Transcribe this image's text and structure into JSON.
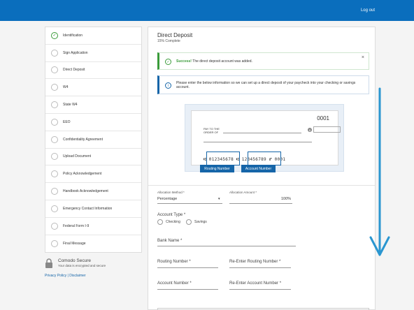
{
  "header": {
    "logout_label": "Log out",
    "brand_color": "#0a6ebd"
  },
  "steps": [
    {
      "label": "Identification",
      "status": "complete"
    },
    {
      "label": "Sign Application",
      "status": "incomplete"
    },
    {
      "label": "Direct Deposit",
      "status": "incomplete"
    },
    {
      "label": "W4",
      "status": "incomplete"
    },
    {
      "label": "State W4",
      "status": "incomplete"
    },
    {
      "label": "EEO",
      "status": "incomplete"
    },
    {
      "label": "Confidentiality Agreement",
      "status": "incomplete"
    },
    {
      "label": "Upload Document",
      "status": "incomplete"
    },
    {
      "label": "Policy Acknowledgement",
      "status": "incomplete"
    },
    {
      "label": "Handbook Acknowledgement",
      "status": "incomplete"
    },
    {
      "label": "Emergency Contact Information",
      "status": "incomplete"
    },
    {
      "label": "Federal Form I-9",
      "status": "incomplete"
    },
    {
      "label": "Final Message",
      "status": "incomplete"
    }
  ],
  "secure": {
    "title": "Comodo Secure",
    "subtitle": "Your data is encrypted and secure",
    "privacy_label": "Privacy Policy",
    "separator": "|",
    "disclaimer_label": "Disclaimer"
  },
  "main": {
    "title": "Direct Deposit",
    "progress_text": "15% Complete",
    "success_alert": {
      "bold": "Success!",
      "text": " The direct deposit account was added.",
      "close": "×"
    },
    "info_alert": {
      "text": "Please enter the below information so we can set up a direct deposit of your paycheck into your checking or savings account."
    },
    "check": {
      "number": "0001",
      "pay_to": "PAY TO THE",
      "order_of": "ORDER OF",
      "dollar": "$",
      "micr": "⑆ 012345678 ⑆   123456789 ⑈   0001",
      "routing_tag": "Routing Number",
      "account_tag": "Account Number"
    },
    "form": {
      "allocation_method_label": "Allocation Method *",
      "allocation_method_value": "Percentage",
      "allocation_amount_label": "Allocation Amount *",
      "allocation_amount_value": "100%",
      "account_type_label": "Account Type *",
      "account_type_options": [
        "Checking",
        "Savings"
      ],
      "bank_name_label": "Bank Name *",
      "routing_label": "Routing Number *",
      "routing_reenter_label": "Re-Enter Routing Number *",
      "account_label": "Account Number *",
      "account_reenter_label": "Re-Enter Account Number *"
    }
  },
  "colors": {
    "success": "#3a9b3a",
    "info": "#1565a8",
    "scroll_arrow": "#2a96d0"
  }
}
